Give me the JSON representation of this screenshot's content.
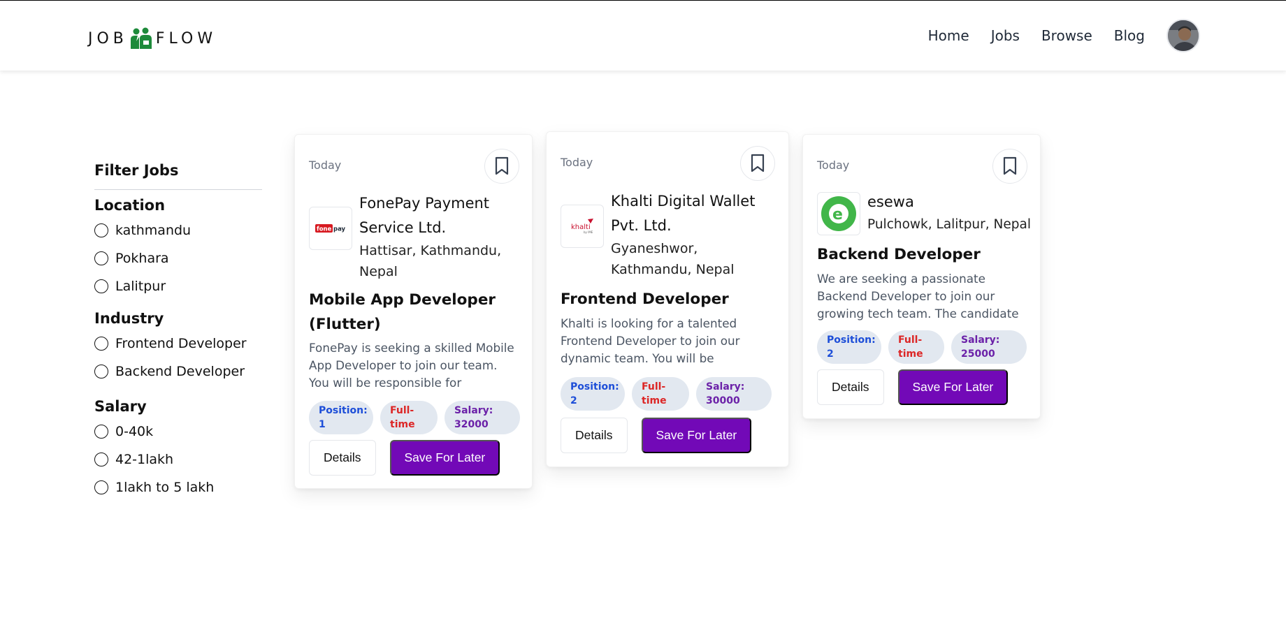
{
  "brand": {
    "left": "JOB",
    "right": "FLOW",
    "logo_color": "#1d8a3a"
  },
  "nav": {
    "items": [
      "Home",
      "Jobs",
      "Browse",
      "Blog"
    ]
  },
  "filter": {
    "title": "Filter Jobs",
    "groups": [
      {
        "title": "Location",
        "options": [
          "kathmandu",
          "Pokhara",
          "Lalitpur"
        ]
      },
      {
        "title": "Industry",
        "options": [
          "Frontend Developer",
          "Backend Developer"
        ]
      },
      {
        "title": "Salary",
        "options": [
          "0-40k",
          "42-1lakh",
          "1lakh to 5 lakh"
        ]
      }
    ]
  },
  "jobs": [
    {
      "date": "Today",
      "company": "FonePay Payment Service Ltd.",
      "location": "Hattisar, Kathmandu, Nepal",
      "logo_text": "fone pay",
      "title": "Mobile App Developer (Flutter)",
      "description": "FonePay is seeking a skilled Mobile App Developer to join our team. You will be responsible for developing a…",
      "position": "Position: 1",
      "type": "Full-time",
      "salary": "Salary: 32000",
      "details_label": "Details",
      "save_label": "Save For Later"
    },
    {
      "date": "Today",
      "company": "Khalti Digital Wallet Pvt. Ltd.",
      "location": "Gyaneshwor, Kathmandu, Nepal",
      "logo_text": "khalti",
      "title": "Frontend Developer",
      "description": "Khalti is looking for a talented Frontend Developer to join our dynamic team. You will be responsib…",
      "position": "Position: 2",
      "type": "Full-time",
      "salary": "Salary: 30000",
      "details_label": "Details",
      "save_label": "Save For Later"
    },
    {
      "date": "Today",
      "company": "esewa",
      "location": "Pulchowk, Lalitpur, Nepal",
      "logo_text": "e",
      "title": "Backend Developer",
      "description": "We are seeking a passionate Backend Developer to join our growing tech team. The candidate will be…",
      "position": "Position: 2",
      "type": "Full-time",
      "salary": "Salary: 25000",
      "details_label": "Details",
      "save_label": "Save For Later"
    }
  ],
  "colors": {
    "accent": "#7209b7",
    "position_text": "#1d4ed8",
    "type_text": "#dc2626",
    "salary_text": "#6b21a8",
    "badge_bg": "#e2e8f0"
  }
}
